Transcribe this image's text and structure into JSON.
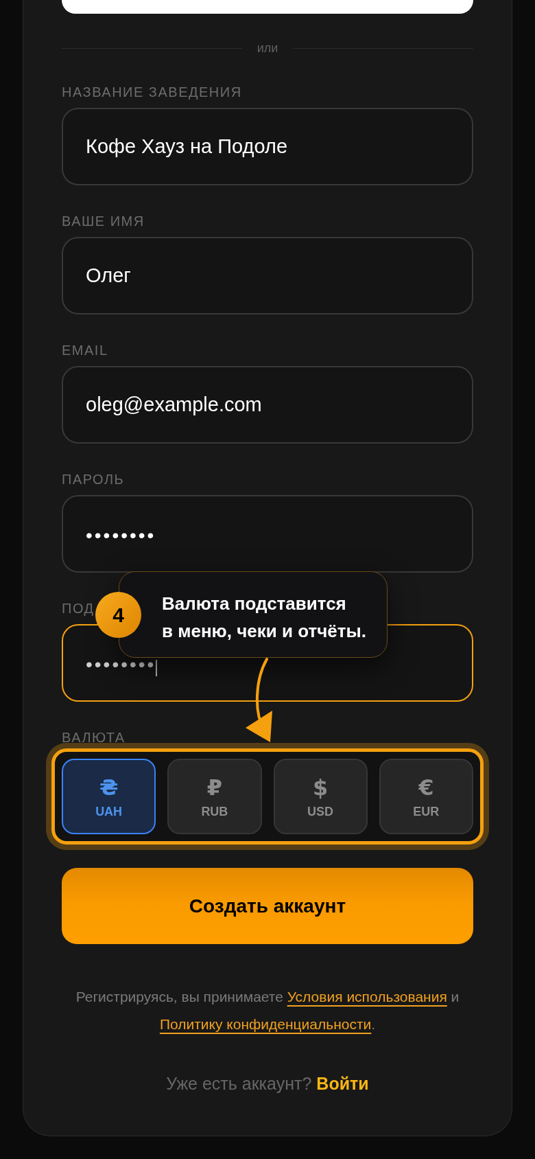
{
  "divider": {
    "text": "или"
  },
  "fields": [
    {
      "label": "НАЗВАНИЕ ЗАВЕДЕНИЯ",
      "value": "Кофе Хауз на Подоле",
      "kind": "text",
      "focused": false
    },
    {
      "label": "ВАШЕ ИМЯ",
      "value": "Олег",
      "kind": "text",
      "focused": false
    },
    {
      "label": "EMAIL",
      "value": "oleg@example.com",
      "kind": "text",
      "focused": false
    },
    {
      "label": "ПАРОЛЬ",
      "value": "••••••••",
      "kind": "secret",
      "focused": false
    },
    {
      "label": "ПОД",
      "value": "••••••••",
      "kind": "secret",
      "focused": true
    }
  ],
  "currency": {
    "label": "ВАЛЮТА",
    "highlighted": true,
    "options": [
      {
        "symbol": "₴",
        "code": "UAH",
        "selected": true
      },
      {
        "symbol": "₽",
        "code": "RUB",
        "selected": false
      },
      {
        "symbol": "$",
        "code": "USD",
        "selected": false
      },
      {
        "symbol": "€",
        "code": "EUR",
        "selected": false
      }
    ]
  },
  "tooltip": {
    "step": "4",
    "text": "Валюта подставится\nв меню, чеки и отчёты."
  },
  "submit": {
    "label": "Создать аккаунт"
  },
  "terms": {
    "parts": [
      {
        "kind": "text",
        "text": "Регистрируясь, вы принимаете "
      },
      {
        "kind": "link",
        "text": "Условия использования"
      },
      {
        "kind": "text",
        "text": " и "
      },
      {
        "kind": "link",
        "text": "Политику конфиденциальности"
      },
      {
        "kind": "text",
        "text": "."
      }
    ]
  },
  "login_prompt": {
    "text": "Уже есть аккаунт?",
    "link": "Войти"
  }
}
